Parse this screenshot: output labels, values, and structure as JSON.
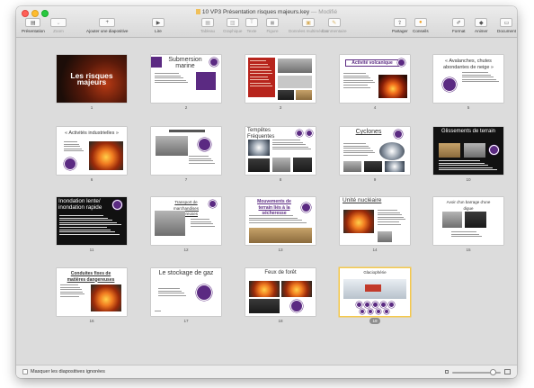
{
  "window": {
    "title": "10 VP3 Présentation risques majeurs.key",
    "title_suffix": " — Modifié"
  },
  "toolbar": {
    "left": [
      {
        "id": "presentation",
        "label": "Présentation",
        "icon": "slide-view-icon"
      },
      {
        "id": "zoom",
        "label": "Zoom",
        "icon": "zoom-popup-icon",
        "dim": true
      },
      {
        "id": "add-slide",
        "label": "Ajouter une diapositive",
        "icon": "plus-icon"
      }
    ],
    "center": [
      {
        "id": "play",
        "label": "Lire",
        "icon": "play-icon"
      },
      {
        "id": "table",
        "label": "Tableau",
        "icon": "table-icon",
        "dim": true
      },
      {
        "id": "chart",
        "label": "Graphique",
        "icon": "chart-icon",
        "dim": true
      },
      {
        "id": "text",
        "label": "Texte",
        "icon": "text-icon",
        "dim": true
      },
      {
        "id": "shape",
        "label": "Figure",
        "icon": "shape-icon",
        "dim": true
      },
      {
        "id": "media",
        "label": "Données multimédias",
        "icon": "media-icon",
        "dim": true
      },
      {
        "id": "comment",
        "label": "Commentaire",
        "icon": "comment-icon",
        "dim": true
      }
    ],
    "right": [
      {
        "id": "share",
        "label": "Partager",
        "icon": "share-icon"
      },
      {
        "id": "tips",
        "label": "Conseils",
        "icon": "lightbulb-icon"
      },
      {
        "id": "format",
        "label": "Format",
        "icon": "paintbrush-icon"
      },
      {
        "id": "animate",
        "label": "Animer",
        "icon": "animate-icon"
      },
      {
        "id": "document",
        "label": "Document",
        "icon": "document-icon"
      }
    ]
  },
  "slides": [
    {
      "number": "1",
      "title": "Les risques majeurs",
      "kind": "dark-title"
    },
    {
      "number": "2",
      "title": "Submersion marine",
      "kind": "purple-title"
    },
    {
      "number": "3",
      "title": "",
      "kind": "red-block"
    },
    {
      "number": "4",
      "title": "Activité volcanique",
      "kind": "volcano"
    },
    {
      "number": "5",
      "title": "« Avalanches, chutes abondantes de neige »",
      "kind": "text-icon"
    },
    {
      "number": "6",
      "title": "« Activités industrielles »",
      "kind": "industrial"
    },
    {
      "number": "7",
      "title": "",
      "kind": "photo-icon"
    },
    {
      "number": "8",
      "title": "Tempêtes Fréquentes",
      "kind": "storms"
    },
    {
      "number": "9",
      "title": "Cyclones",
      "kind": "cyclones"
    },
    {
      "number": "10",
      "title": "Glissements de terrain",
      "kind": "dark-landslide"
    },
    {
      "number": "11",
      "title": "Inondation lente/ inondation rapide",
      "kind": "dark-flood"
    },
    {
      "number": "12",
      "title": "Transport de marchandises dangereuses",
      "kind": "transport"
    },
    {
      "number": "13",
      "title": "Mouvements de terrain liés à la sécheresse",
      "kind": "drought"
    },
    {
      "number": "14",
      "title": "Unité nucléaire",
      "kind": "nuclear"
    },
    {
      "number": "15",
      "title": "Avoir d'un barrage d'une digue",
      "kind": "dam"
    },
    {
      "number": "16",
      "title": "Conduites fixes de matières dangereuses",
      "kind": "pipes"
    },
    {
      "number": "17",
      "title": "Le stockage de gaz",
      "kind": "gas"
    },
    {
      "number": "18",
      "title": "Feux de forêt",
      "kind": "forest"
    },
    {
      "number": "19",
      "title": "Glaciophérie",
      "kind": "glacier",
      "selected": true
    }
  ],
  "statusbar": {
    "skipped_label": "Masquer les diapositives ignorées",
    "zoom_level": 0.85
  },
  "colors": {
    "accent_purple": "#5b2a82",
    "selection": "#f5c84c"
  }
}
